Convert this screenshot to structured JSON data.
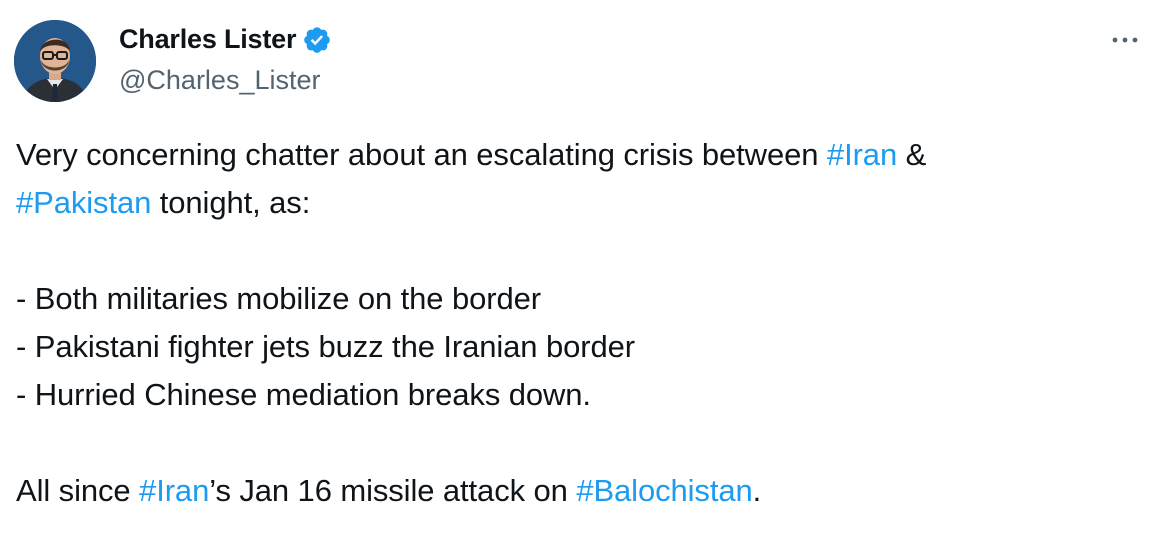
{
  "author": {
    "display_name": "Charles Lister",
    "handle": "@Charles_Lister",
    "verified_icon": "verified-badge-icon",
    "avatar": "profile-photo",
    "more_icon": "more-options-icon"
  },
  "tweet": {
    "line1": {
      "pre": "Very concerning chatter about an escalating crisis between ",
      "tag1": "#Iran",
      "post": " &"
    },
    "line2": {
      "tag": "#Pakistan",
      "post": " tonight, as:"
    },
    "bullets": [
      "- Both militaries mobilize on the border",
      "- Pakistani fighter jets buzz the Iranian border",
      "- Hurried Chinese mediation breaks down."
    ],
    "final": {
      "pre": "All since ",
      "tag1": "#Iran",
      "mid": "’s Jan 16 missile attack on ",
      "tag2": "#Balochistan",
      "post": "."
    }
  },
  "colors": {
    "link": "#1d9bf0",
    "handle": "#536471",
    "text": "#0f1419"
  }
}
